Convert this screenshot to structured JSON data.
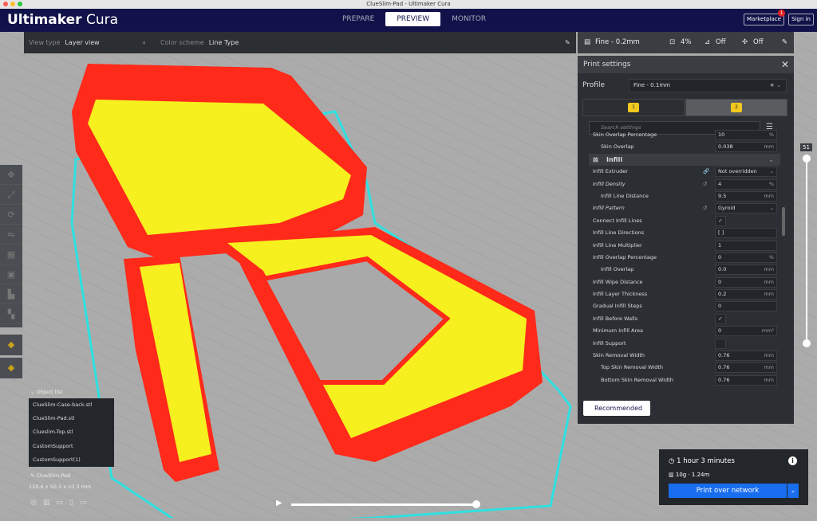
{
  "window": {
    "title": "ClueSlim-Pad - Ultimaker Cura"
  },
  "header": {
    "logo_bold": "Ultimaker",
    "logo_light": " Cura",
    "stages": [
      "PREPARE",
      "PREVIEW",
      "MONITOR"
    ],
    "marketplace": "Marketplace",
    "marketplace_badge": "1",
    "signin": "Sign in"
  },
  "toolbar": {
    "view_type_label": "View type",
    "view_type": "Layer view",
    "color_scheme_label": "Color scheme",
    "color_scheme": "Line Type"
  },
  "quick": {
    "profile": "Fine - 0.2mm",
    "infill": "4%",
    "support": "Off",
    "adhesion": "Off"
  },
  "panel": {
    "title": "Print settings",
    "profile_label": "Profile",
    "profile_value": "Fine - 0.1mm",
    "extruder1": "1",
    "extruder2": "2",
    "search_placeholder": "Search settings",
    "recommended": "Recommended",
    "rows": [
      {
        "name": "Skin Overlap Percentage",
        "value": "10",
        "unit": "%",
        "ind": false
      },
      {
        "name": "Skin Overlap",
        "value": "0.038",
        "unit": "mm",
        "ind": true
      },
      {
        "name": "Infill",
        "cat": true
      },
      {
        "name": "Infill Extruder",
        "value": "Not overridden",
        "unit": "⌄",
        "act": "🔗"
      },
      {
        "name": "Infill Density",
        "value": "4",
        "unit": "%",
        "it": true,
        "act": "↺"
      },
      {
        "name": "Infill Line Distance",
        "value": "9.5",
        "unit": "mm",
        "ind": true
      },
      {
        "name": "Infill Pattern",
        "value": "Gyroid",
        "unit": "⌄",
        "it": true,
        "act": "↺"
      },
      {
        "name": "Connect Infill Lines",
        "check": "✓"
      },
      {
        "name": "Infill Line Directions",
        "value": "[ ]",
        "unit": ""
      },
      {
        "name": "Infill Line Multiplier",
        "value": "1",
        "unit": ""
      },
      {
        "name": "Infill Overlap Percentage",
        "value": "0",
        "unit": "%"
      },
      {
        "name": "Infill Overlap",
        "value": "0.0",
        "unit": "mm",
        "ind": true
      },
      {
        "name": "Infill Wipe Distance",
        "value": "0",
        "unit": "mm"
      },
      {
        "name": "Infill Layer Thickness",
        "value": "0.2",
        "unit": "mm"
      },
      {
        "name": "Gradual Infill Steps",
        "value": "0",
        "unit": ""
      },
      {
        "name": "Infill Before Walls",
        "check": "✓"
      },
      {
        "name": "Minimum Infill Area",
        "value": "0",
        "unit": "mm²"
      },
      {
        "name": "Infill Support",
        "check": ""
      },
      {
        "name": "Skin Removal Width",
        "value": "0.76",
        "unit": "mm"
      },
      {
        "name": "Top Skin Removal Width",
        "value": "0.76",
        "unit": "mm",
        "ind": true
      },
      {
        "name": "Bottom Skin Removal Width",
        "value": "0.76",
        "unit": "mm",
        "ind": true
      }
    ]
  },
  "objects": {
    "header": "Object list",
    "items": [
      "ClueSlim-Case-back.stl",
      "ClueSlim-Pad.stl",
      "Clueslim-Top.stl",
      "CustomSupport",
      "CustomSupport(1)"
    ],
    "selected": "ClueSlim-Pad",
    "dimensions": "110.6 x 50.3 x 10.3 mm"
  },
  "layer_slider": {
    "value": "51"
  },
  "job": {
    "time": "1 hour 3 minutes",
    "material": "10g · 1.24m",
    "print_button": "Print over network"
  },
  "colors": {
    "accent": "#196ef0",
    "header": "#12124a",
    "wall": "#ff2a1a",
    "skin": "#f5f01e",
    "travel": "#2fe0e0"
  }
}
